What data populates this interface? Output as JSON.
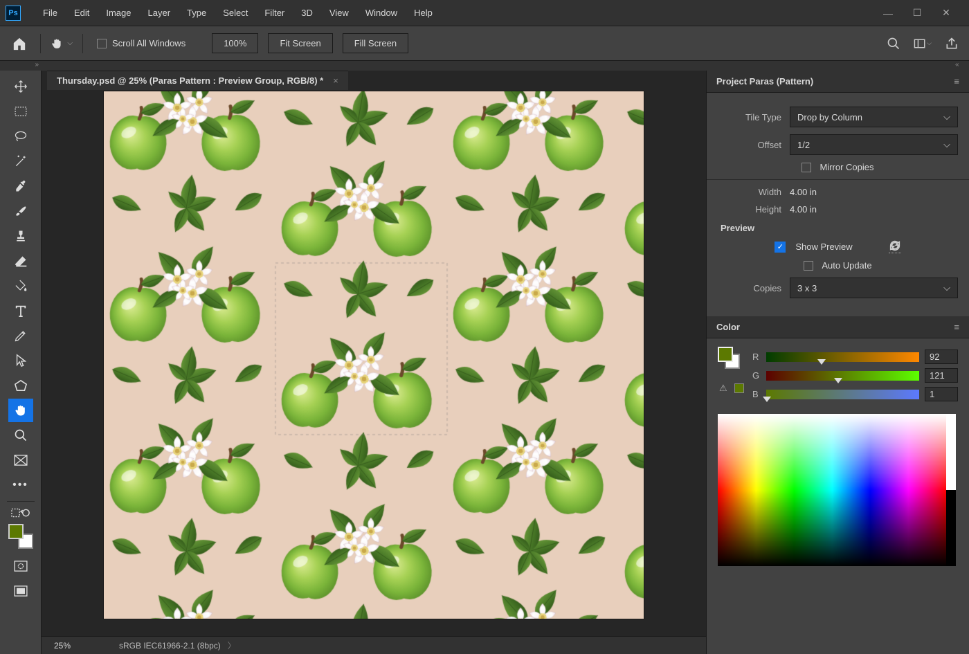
{
  "menu": [
    "File",
    "Edit",
    "Image",
    "Layer",
    "Type",
    "Select",
    "Filter",
    "3D",
    "View",
    "Window",
    "Help"
  ],
  "optionsBar": {
    "scrollAll": "Scroll All Windows",
    "zoom": "100%",
    "fit": "Fit Screen",
    "fill": "Fill Screen"
  },
  "document": {
    "tab": "Thursday.psd @ 25% (Paras Pattern : Preview Group, RGB/8) *"
  },
  "status": {
    "zoom": "25%",
    "profile": "sRGB IEC61966-2.1 (8bpc)"
  },
  "patternPanel": {
    "title": "Project Paras (Pattern)",
    "tileTypeLabel": "Tile Type",
    "tileType": "Drop by Column",
    "offsetLabel": "Offset",
    "offset": "1/2",
    "mirror": "Mirror Copies",
    "widthLabel": "Width",
    "width": "4.00 in",
    "heightLabel": "Height",
    "height": "4.00 in",
    "previewTitle": "Preview",
    "showPreview": "Show Preview",
    "autoUpdate": "Auto Update",
    "copiesLabel": "Copies",
    "copies": "3 x 3"
  },
  "colorPanel": {
    "title": "Color",
    "r": {
      "label": "R",
      "value": "92",
      "pct": 36
    },
    "g": {
      "label": "G",
      "value": "121",
      "pct": 47
    },
    "b": {
      "label": "B",
      "value": "1",
      "pct": 0.4
    },
    "fg": "#5c7901"
  },
  "canvas": {
    "bg": "#e8cfbc"
  }
}
